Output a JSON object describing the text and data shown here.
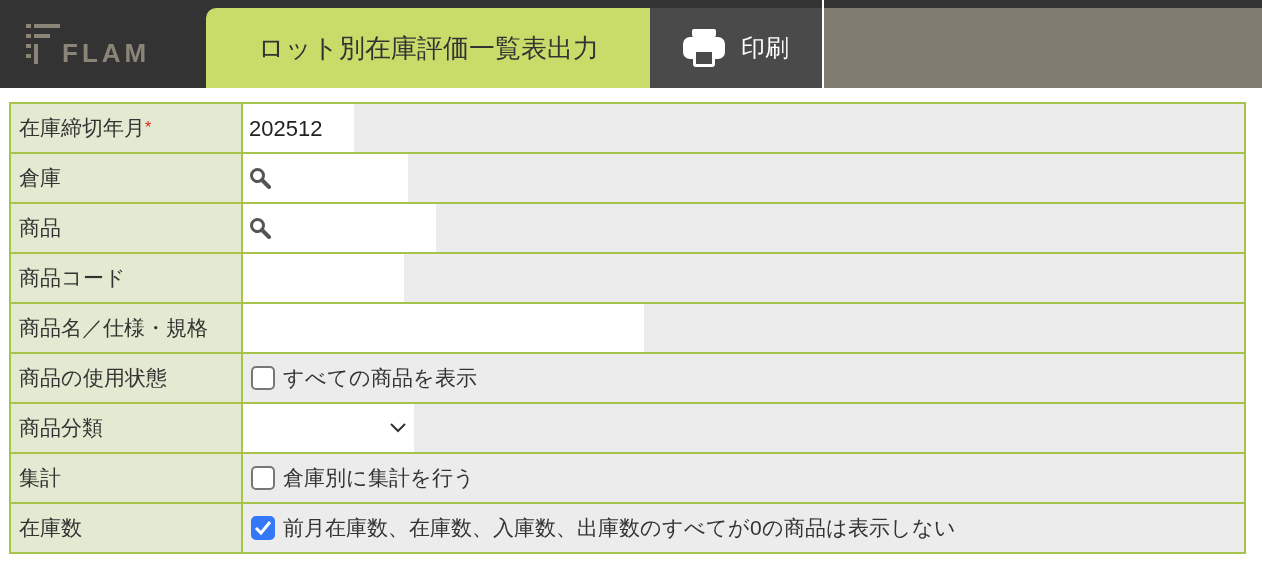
{
  "header": {
    "logo": "FLAM",
    "tab": {
      "label": "ロット別在庫評価一覧表出力",
      "selected": true
    },
    "print_button": {
      "label": "印刷"
    }
  },
  "form": {
    "rows": [
      {
        "kind": "text",
        "label": "在庫締切年月",
        "required_mark": "*",
        "value": "202512"
      },
      {
        "kind": "search",
        "label": "倉庫"
      },
      {
        "kind": "search",
        "label": "商品"
      },
      {
        "kind": "text",
        "label": "商品コード"
      },
      {
        "kind": "text",
        "label": "商品名／仕様・規格"
      },
      {
        "kind": "checkbox",
        "label": "商品の使用状態",
        "option": "すべての商品を表示",
        "checked": false
      },
      {
        "kind": "select",
        "label": "商品分類"
      },
      {
        "kind": "checkbox",
        "label": "集計",
        "option": "倉庫別に集計を行う",
        "checked": false
      },
      {
        "kind": "checkbox",
        "label": "在庫数",
        "option": "前月在庫数、在庫数、入庫数、出庫数のすべてが0の商品は表示しない",
        "checked": true
      }
    ]
  }
}
